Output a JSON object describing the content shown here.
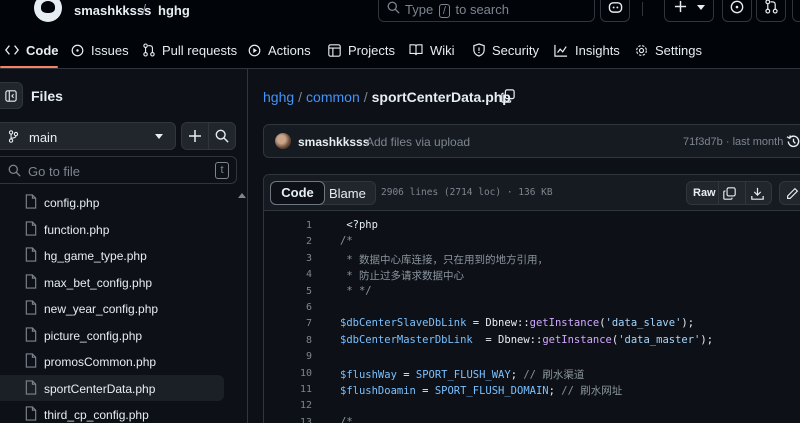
{
  "header": {
    "owner": "smashkksss",
    "separator": "/",
    "repo": "hghg",
    "search_text": "Type",
    "search_key": "/",
    "search_suffix": "to search"
  },
  "nav": {
    "tabs": [
      "Code",
      "Issues",
      "Pull requests",
      "Actions",
      "Projects",
      "Wiki",
      "Security",
      "Insights",
      "Settings"
    ],
    "active_tab": "Code",
    "underline_color": "#f78166"
  },
  "sidebar": {
    "title": "Files",
    "branch": "main",
    "goto_placeholder": "Go to file",
    "goto_key": "t",
    "files": [
      "config.php",
      "function.php",
      "hg_game_type.php",
      "max_bet_config.php",
      "new_year_config.php",
      "picture_config.php",
      "promosCommon.php",
      "sportCenterData.php",
      "third_cp_config.php"
    ],
    "selected_file": "sportCenterData.php"
  },
  "breadcrumb": {
    "repo": "hghg",
    "folder": "common",
    "file": "sportCenterData.php",
    "sep": "/"
  },
  "commit": {
    "author": "smashkksss",
    "message": "Add files via upload",
    "hash": "71f3d7b",
    "dot": "·",
    "time": "last month"
  },
  "file": {
    "view_code": "Code",
    "view_blame": "Blame",
    "meta": "2906 lines (2714 loc) · 136 KB",
    "raw_label": "Raw"
  },
  "code_lines": [
    {
      "n": "1",
      "html": " &lt;?php"
    },
    {
      "n": "2",
      "html": "<span class=\"cmt\">/*</span>"
    },
    {
      "n": "3",
      "html": "<span class=\"cmt\"> * 数据中心库连接，只在用到的地方引用，</span>"
    },
    {
      "n": "4",
      "html": "<span class=\"cmt\"> * 防止过多请求数据中心</span>"
    },
    {
      "n": "5",
      "html": "<span class=\"cmt\"> * */</span>"
    },
    {
      "n": "6",
      "html": ""
    },
    {
      "n": "7",
      "html": "<span class=\"var\">$dbCenterSlaveDbLink</span> = Dbnew::<span class=\"fn\">getInstance</span>(<span class=\"str\">'data_slave'</span>);"
    },
    {
      "n": "8",
      "html": "<span class=\"var\">$dbCenterMasterDbLink</span>  = Dbnew::<span class=\"fn\">getInstance</span>(<span class=\"str\">'data_master'</span>);"
    },
    {
      "n": "9",
      "html": ""
    },
    {
      "n": "10",
      "html": "<span class=\"var\">$flushWay</span> = <span class=\"cst\">SPORT_FLUSH_WAY</span>; <span class=\"cmt\">// 刷水渠道</span>"
    },
    {
      "n": "11",
      "html": "<span class=\"var\">$flushDoamin</span> = <span class=\"cst\">SPORT_FLUSH_DOMAIN</span>; <span class=\"cmt\">// 刷水网址</span>"
    },
    {
      "n": "12",
      "html": ""
    },
    {
      "n": "13",
      "html": "<span class=\"cmt\">/*</span>"
    }
  ]
}
